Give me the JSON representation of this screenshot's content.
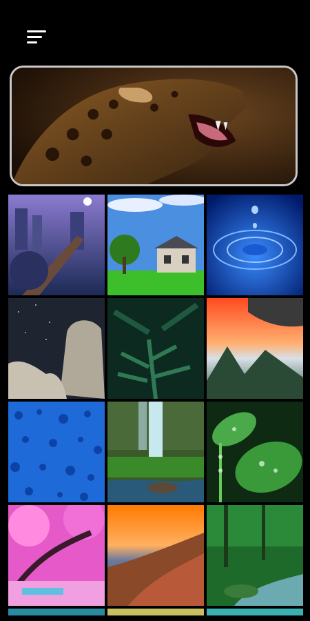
{
  "header": {
    "menu_icon": "sort-menu-icon"
  },
  "featured": {
    "icon": "leopard-wallpaper",
    "colors": {
      "border": "#c8c8c8",
      "bg": "#2a1a0a"
    }
  },
  "wallpapers": [
    "fantasy-bridge",
    "country-house",
    "water-drop",
    "starry-rocks",
    "fern-leaves",
    "mountain-sunset",
    "blue-raindrops",
    "jungle-waterfall",
    "leaf-dewdrops",
    "pink-blossom-tree",
    "sunset-hills",
    "forest-stream"
  ]
}
